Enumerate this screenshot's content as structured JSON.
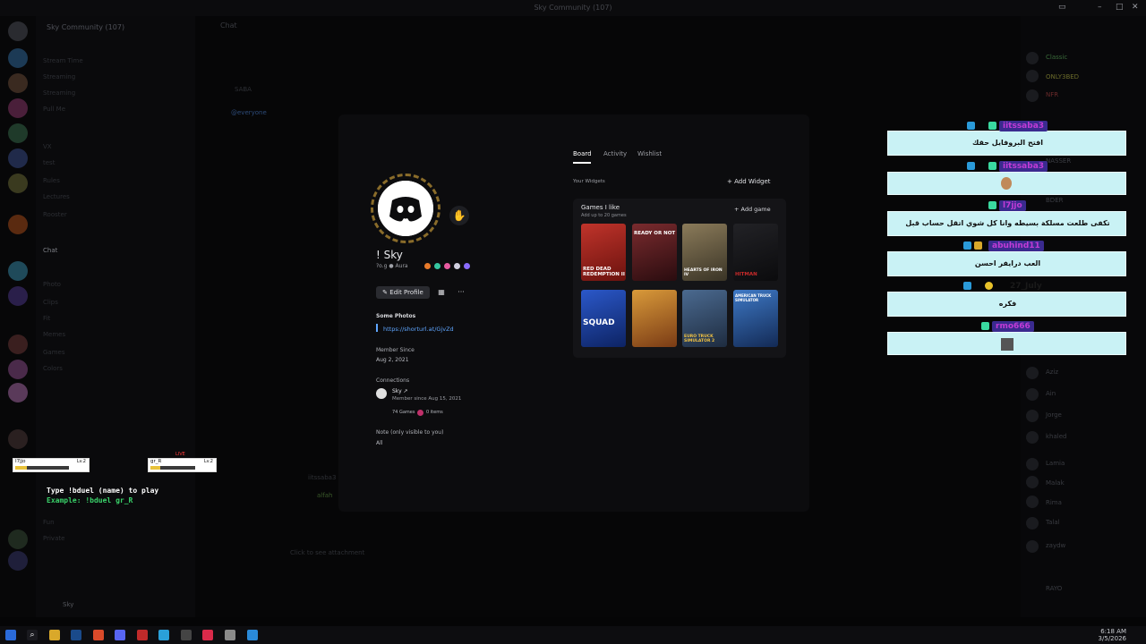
{
  "window": {
    "title": "Sky Community (107)"
  },
  "corner_badge": "20",
  "sidebar": {
    "server_name": "Sky Community (107)",
    "channels": [
      "Stream Time",
      "Streaming",
      "Streaming",
      "Pull Me",
      "VX",
      "test",
      "Rules",
      "Lectures",
      "Rooster",
      "Chat",
      "Photo",
      "Clips",
      "Fit",
      "Memes",
      "Games",
      "Colors",
      "Fun",
      "Private"
    ],
    "active_channel": "Chat",
    "user": "Sky"
  },
  "chat": {
    "channel": "Chat",
    "mention": "@everyone",
    "attachment_hint": "Click to see attachment",
    "author_1": "SABA",
    "author_2": "iitssaba3",
    "author_3": "alfah"
  },
  "members": {
    "names": [
      "Classic",
      "ONLY3BED",
      "NFR",
      "wrm",
      "NASSER",
      "BDER",
      "Astral",
      "Aziz",
      "Ain",
      "Jorge",
      "khaled",
      "Lamia",
      "Malak",
      "Rima",
      "Talal",
      "zaydw",
      "RAYO"
    ],
    "tags": [
      "GOLD",
      "STAR",
      "Aura"
    ]
  },
  "profile": {
    "name": "! Sky",
    "subtitle": "?o.g",
    "aura_label": "Aura",
    "edit_label": "Edit Profile",
    "photos_heading": "Some Photos",
    "photos_link": "https://shorturl.at/GjvZd",
    "member_since_heading": "Member Since",
    "member_since": "Aug 2, 2021",
    "connections_heading": "Connections",
    "connection_name": "Sky",
    "connection_since": "Member since Aug 15, 2021",
    "connection_games": "74 Games",
    "connection_items": "0 items",
    "note_heading": "Note (only visible to you)",
    "note_value": "All",
    "tabs": [
      "Board",
      "Activity",
      "Wishlist"
    ],
    "widgets_label": "Your Widgets",
    "add_widget": "Add Widget",
    "games_heading": "Games I like",
    "games_sub": "Add up to 20 games",
    "add_game": "Add game",
    "games": [
      "RED DEAD REDEMPTION II",
      "READY OR NOT",
      "HEARTS OF IRON IV",
      "HITMAN",
      "SQUAD",
      "",
      "EURO TRUCK SIMULATOR 2",
      "AMERICAN TRUCK SIMULATOR"
    ]
  },
  "overlay_chat": [
    {
      "user": "iitssaba3",
      "text": "افتح البروفايل حقك"
    },
    {
      "user": "iitssaba3",
      "text": ""
    },
    {
      "user": "l7jjo",
      "text": "تكفى طلعت مسلكة بسيطه وانا كل شوي اتقل حساب قبل"
    },
    {
      "user": "abuhind11",
      "text": "العب درايفر احسن"
    },
    {
      "user": "27_July",
      "text": "فكره"
    },
    {
      "user": "rmo666",
      "text": ""
    }
  ],
  "duel": {
    "p1_name": "I7jjo",
    "p1_level": "Lv.2",
    "p2_name": "gr_R",
    "p2_level": "Lv.2",
    "live": "LIVE",
    "line1": "Type !bduel (name) to play",
    "line2": "Example: !bduel gr_R"
  },
  "taskbar": {
    "time": "6:18 AM",
    "date": "3/5/2026"
  },
  "colors": {
    "accent_link": "#5fa6ff",
    "overlay_bg": "#c9f2f5",
    "overlay_user": "#c23bd6"
  }
}
